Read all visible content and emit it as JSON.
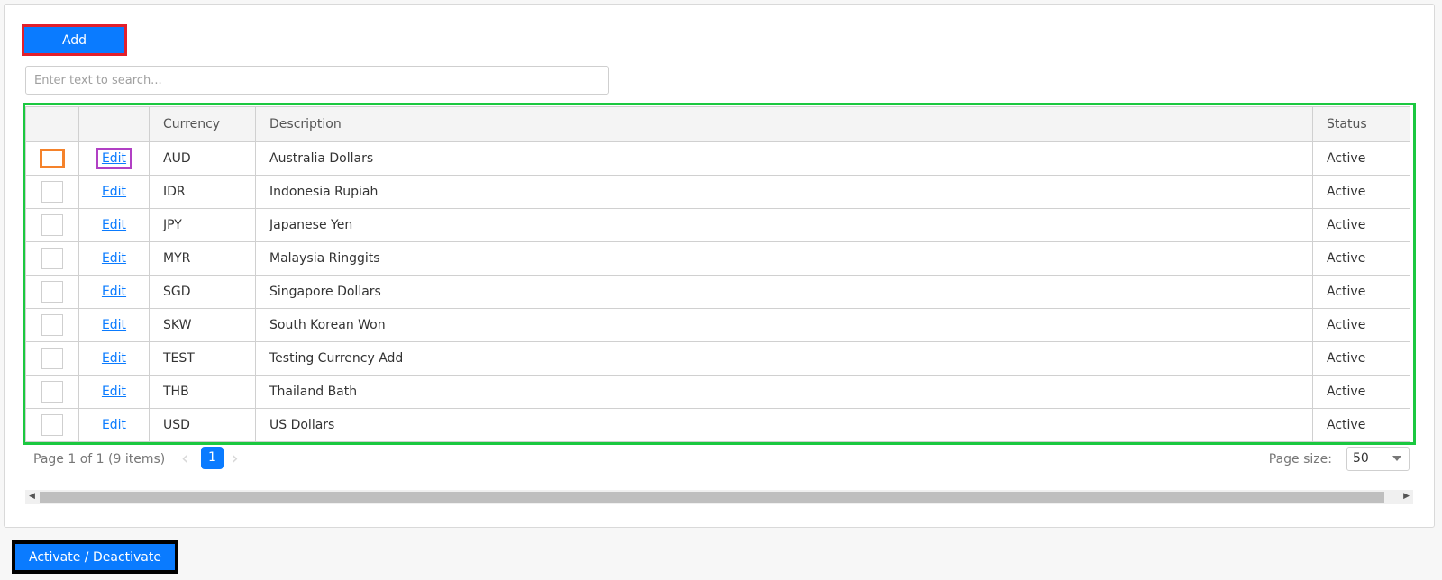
{
  "toolbar": {
    "add_label": "Add",
    "search_placeholder": "Enter text to search...",
    "search_value": ""
  },
  "grid": {
    "columns": [
      "",
      "",
      "Currency",
      "Description",
      "Status"
    ],
    "edit_label": "Edit",
    "rows": [
      {
        "currency": "AUD",
        "description": "Australia Dollars",
        "status": "Active"
      },
      {
        "currency": "IDR",
        "description": "Indonesia Rupiah",
        "status": "Active"
      },
      {
        "currency": "JPY",
        "description": "Japanese Yen",
        "status": "Active"
      },
      {
        "currency": "MYR",
        "description": "Malaysia Ringgits",
        "status": "Active"
      },
      {
        "currency": "SGD",
        "description": "Singapore Dollars",
        "status": "Active"
      },
      {
        "currency": "SKW",
        "description": "South Korean Won",
        "status": "Active"
      },
      {
        "currency": "TEST",
        "description": "Testing Currency Add",
        "status": "Active"
      },
      {
        "currency": "THB",
        "description": "Thailand Bath",
        "status": "Active"
      },
      {
        "currency": "USD",
        "description": "US Dollars",
        "status": "Active"
      }
    ]
  },
  "pager": {
    "summary": "Page 1 of 1 (9 items)",
    "current_page": "1",
    "prev_icon": "‹",
    "next_icon": "›",
    "page_size_label": "Page size:",
    "page_size_value": "50"
  },
  "scrollbar": {
    "left_arrow": "◀",
    "right_arrow": "▶"
  },
  "footer": {
    "activate_label": "Activate / Deactivate"
  },
  "colors": {
    "primary": "#0a7bff",
    "add_highlight": "#e2202b",
    "grid_highlight": "#1bc840",
    "checkbox_highlight": "#f5822a",
    "edit_highlight": "#b140c4",
    "activate_highlight": "#000000"
  }
}
